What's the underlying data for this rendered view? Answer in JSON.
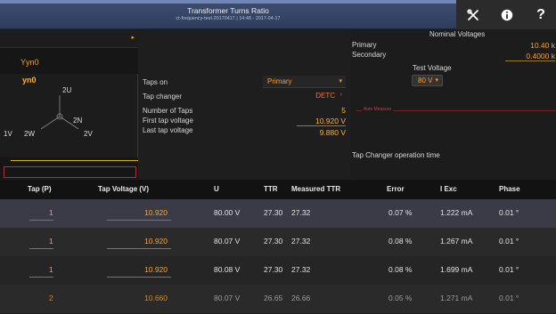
{
  "header": {
    "title": "Transformer Turns Ratio",
    "subtitle": "ct-frequency-test-20170417 | 14:48 - 2017-04-17",
    "buttons": [
      {
        "icon": "tools-icon"
      },
      {
        "icon": "info-icon"
      },
      {
        "icon": "help-icon",
        "label": "?"
      }
    ]
  },
  "left_panel": {
    "vector_group": "Yyn0",
    "diagram": {
      "title": "yn0",
      "labels": {
        "top": "2U",
        "middle": "2N",
        "left": "1V",
        "left2": "2W",
        "right": "2V"
      }
    }
  },
  "parameters": {
    "taps_on_label": "Taps on",
    "taps_on_value": "Primary",
    "tap_changer_label": "Tap changer",
    "tap_changer_value": "DETC",
    "number_of_taps_label": "Number of Taps",
    "number_of_taps_value": "5",
    "first_tap_voltage_label": "First tap voltage",
    "first_tap_voltage_value": "10.920 V",
    "last_tap_voltage_label": "Last tap voltage",
    "last_tap_voltage_value": "9.880 V"
  },
  "right_panel": {
    "nominal_voltages_label": "Nominal Voltages",
    "primary_label": "Primary",
    "primary_value": "10.40 k",
    "secondary_label": "Secondary",
    "secondary_value": "0.4000 k",
    "test_voltage_label": "Test Voltage",
    "test_voltage_value": "80 V",
    "red_note": "Auto Measure",
    "tap_changer_operation_time_label": "Tap Changer operation time"
  },
  "table": {
    "columns": [
      "Tap (P)",
      "Tap Voltage (V)",
      "U",
      "TTR",
      "Measured TTR",
      "Error",
      "I Exc",
      "Phase"
    ],
    "rows": [
      [
        "1",
        "10.920",
        "80.00 V",
        "27.30",
        "27.32",
        "0.07 %",
        "1.222 mA",
        "0.01 °"
      ],
      [
        "1",
        "10.920",
        "80.07 V",
        "27.30",
        "27.32",
        "0.08 %",
        "1.267 mA",
        "0.01 °"
      ],
      [
        "1",
        "10.920",
        "80.08 V",
        "27.30",
        "27.32",
        "0.08 %",
        "1.699 mA",
        "0.01 °"
      ],
      [
        "2",
        "10.660",
        "80.07 V",
        "26.65",
        "26.66",
        "0.05 %",
        "1.271 mA",
        "0.01 °"
      ]
    ]
  }
}
